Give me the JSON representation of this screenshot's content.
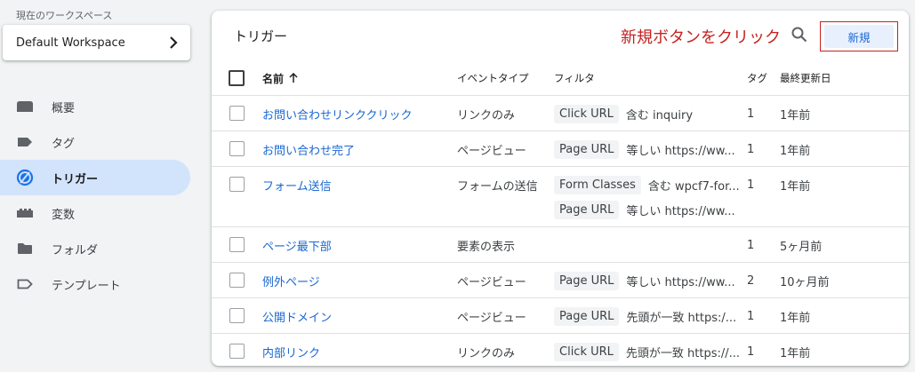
{
  "sidebar": {
    "workspace_label": "現在のワークスペース",
    "workspace_name": "Default Workspace",
    "items": [
      {
        "label": "概要",
        "icon": "overview-icon"
      },
      {
        "label": "タグ",
        "icon": "tag-icon"
      },
      {
        "label": "トリガー",
        "icon": "trigger-icon",
        "active": true
      },
      {
        "label": "変数",
        "icon": "variable-icon"
      },
      {
        "label": "フォルダ",
        "icon": "folder-icon"
      },
      {
        "label": "テンプレート",
        "icon": "template-icon"
      }
    ]
  },
  "main": {
    "title": "トリガー",
    "new_button": "新規",
    "annotation": "新規ボタンをクリック",
    "columns": {
      "name": "名前",
      "event": "イベントタイプ",
      "filter": "フィルタ",
      "tag": "タグ",
      "updated": "最終更新日"
    },
    "rows": [
      {
        "name": "お問い合わせリンククリック",
        "event": "リンクのみ",
        "filters": [
          {
            "chip": "Click URL",
            "text": "含む inquiry"
          }
        ],
        "tag": "1",
        "updated": "1年前"
      },
      {
        "name": "お問い合わせ完了",
        "event": "ページビュー",
        "filters": [
          {
            "chip": "Page URL",
            "text": "等しい https://ww..."
          }
        ],
        "tag": "1",
        "updated": "1年前"
      },
      {
        "name": "フォーム送信",
        "event": "フォームの送信",
        "filters": [
          {
            "chip": "Form Classes",
            "text": "含む wpcf7-for..."
          },
          {
            "chip": "Page URL",
            "text": "等しい https://ww..."
          }
        ],
        "tag": "1",
        "updated": "1年前"
      },
      {
        "name": "ページ最下部",
        "event": "要素の表示",
        "filters": [],
        "tag": "1",
        "updated": "5ヶ月前"
      },
      {
        "name": "例外ページ",
        "event": "ページビュー",
        "filters": [
          {
            "chip": "Page URL",
            "text": "等しい https://ww..."
          }
        ],
        "tag": "2",
        "updated": "10ヶ月前"
      },
      {
        "name": "公開ドメイン",
        "event": "ページビュー",
        "filters": [
          {
            "chip": "Page URL",
            "text": "先頭が一致 https:/..."
          }
        ],
        "tag": "1",
        "updated": "1年前"
      },
      {
        "name": "内部リンク",
        "event": "リンクのみ",
        "filters": [
          {
            "chip": "Click URL",
            "text": "先頭が一致 https://..."
          }
        ],
        "tag": "1",
        "updated": "1年前"
      }
    ]
  }
}
